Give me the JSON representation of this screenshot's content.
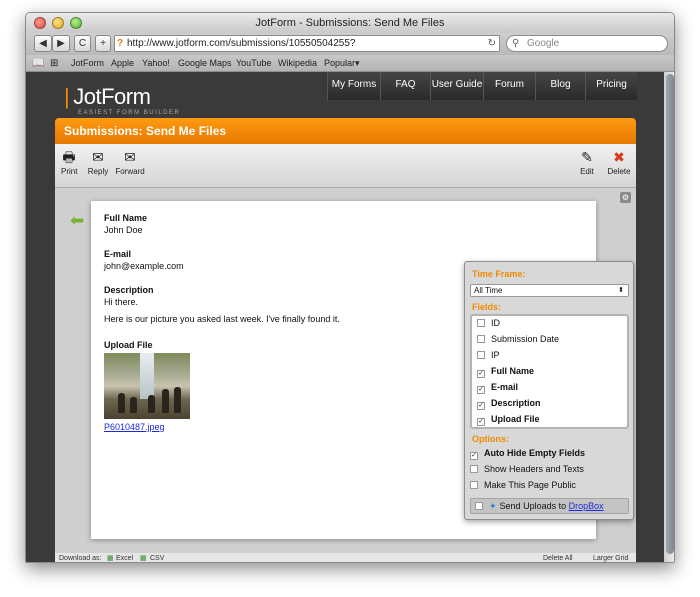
{
  "window": {
    "title": "JotForm - Submissions: Send Me Files"
  },
  "browser": {
    "back": "◀",
    "forward": "▶",
    "stop": "C",
    "add": "+",
    "url": "http://www.jotform.com/submissions/10550504255?",
    "search_placeholder": "Google",
    "bookmarks": [
      "JotForm",
      "Apple",
      "Yahoo!",
      "Google Maps",
      "YouTube",
      "Wikipedia",
      "Popular▾"
    ]
  },
  "site": {
    "logo": "JotForm",
    "tagline": "EASIEST FORM BUILDER",
    "nav": [
      "My Forms",
      "FAQ",
      "User Guide",
      "Forum",
      "Blog",
      "Pricing"
    ]
  },
  "page": {
    "title": "Submissions: Send Me Files",
    "actions": {
      "print": "Print",
      "reply": "Reply",
      "forward": "Forward",
      "edit": "Edit",
      "delete": "Delete"
    }
  },
  "submission": {
    "full_name_label": "Full Name",
    "full_name": "John Doe",
    "email_label": "E-mail",
    "email": "john@example.com",
    "description_label": "Description",
    "description_1": "Hi there.",
    "description_2": "Here is our picture you asked last week. I've finally found it.",
    "upload_label": "Upload File",
    "file_name": "P6010487.jpeg"
  },
  "settings": {
    "time_frame_label": "Time Frame:",
    "time_frame_value": "All Time",
    "fields_label": "Fields:",
    "fields": [
      {
        "label": "ID",
        "checked": false
      },
      {
        "label": "Submission Date",
        "checked": false
      },
      {
        "label": "IP",
        "checked": false
      },
      {
        "label": "Full Name",
        "checked": true
      },
      {
        "label": "E-mail",
        "checked": true
      },
      {
        "label": "Description",
        "checked": true
      },
      {
        "label": "Upload File",
        "checked": true
      }
    ],
    "options_label": "Options:",
    "options": [
      {
        "label": "Auto Hide Empty Fields",
        "checked": true
      },
      {
        "label": "Show Headers and Texts",
        "checked": false
      },
      {
        "label": "Make This Page Public",
        "checked": false
      }
    ],
    "send_uploads_text": "Send Uploads to ",
    "dropbox_link": "DropBox"
  },
  "footer": {
    "download_as": "Download as:",
    "excel": "Excel",
    "csv": "CSV",
    "delete_all": "Delete All",
    "larger_grid": "Larger Grid"
  }
}
